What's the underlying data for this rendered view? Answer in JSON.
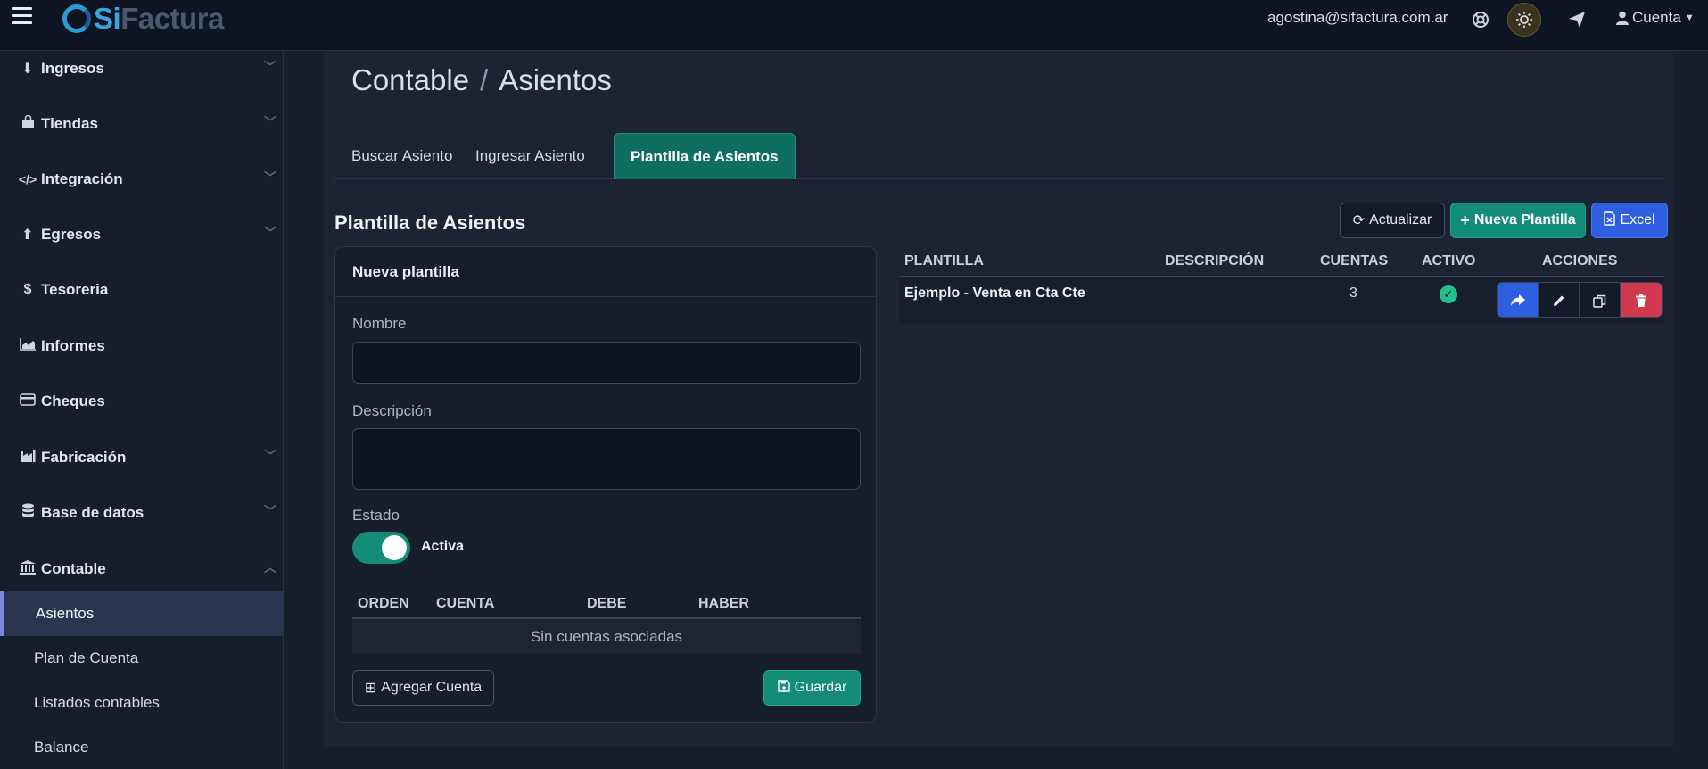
{
  "app": {
    "logo_prefix": "Si",
    "logo_suffix": "Factura"
  },
  "topbar": {
    "email": "agostina@sifactura.com.ar",
    "account_label": "Cuenta",
    "icons": [
      "menu-icon",
      "support-icon",
      "theme-toggle-icon",
      "send-icon",
      "user-icon",
      "caret-down-icon"
    ]
  },
  "sidebar": {
    "items": [
      {
        "label": "Ingresos",
        "icon": "download-icon",
        "has_submenu": true
      },
      {
        "label": "Tiendas",
        "icon": "bag-icon",
        "has_submenu": true
      },
      {
        "label": "Integración",
        "icon": "code-icon",
        "has_submenu": true
      },
      {
        "label": "Egresos",
        "icon": "upload-icon",
        "has_submenu": true
      },
      {
        "label": "Tesoreria",
        "icon": "dollar-icon",
        "has_submenu": false
      },
      {
        "label": "Informes",
        "icon": "area-chart-icon",
        "has_submenu": false
      },
      {
        "label": "Cheques",
        "icon": "card-icon",
        "has_submenu": false
      },
      {
        "label": "Fabricación",
        "icon": "factory-icon",
        "has_submenu": true
      },
      {
        "label": "Base de datos",
        "icon": "database-icon",
        "has_submenu": true
      },
      {
        "label": "Contable",
        "icon": "bank-icon",
        "has_submenu": true,
        "expanded": true
      }
    ],
    "subitems": [
      {
        "label": "Asientos",
        "active": true
      },
      {
        "label": "Plan de Cuenta",
        "active": false
      },
      {
        "label": "Listados contables",
        "active": false
      },
      {
        "label": "Balance",
        "active": false
      }
    ]
  },
  "breadcrumb": {
    "parent": "Contable",
    "separator": "/",
    "current": "Asientos"
  },
  "tabs": [
    {
      "label": "Buscar Asiento",
      "active": false
    },
    {
      "label": "Ingresar Asiento",
      "active": false
    },
    {
      "label": "Plantilla de Asientos",
      "active": true
    }
  ],
  "section": {
    "title": "Plantilla de Asientos",
    "buttons": {
      "refresh": "Actualizar",
      "new_template": "Nueva Plantilla",
      "excel": "Excel"
    }
  },
  "form": {
    "header": "Nueva plantilla",
    "name_label": "Nombre",
    "name_value": "",
    "description_label": "Descripción",
    "description_value": "",
    "state_label": "Estado",
    "state_value": "Activa",
    "state_on": true,
    "table_headers": [
      "ORDEN",
      "CUENTA",
      "DEBE",
      "HABER"
    ],
    "empty_text": "Sin cuentas asociadas",
    "add_account_label": "Agregar Cuenta",
    "save_label": "Guardar"
  },
  "templates_table": {
    "headers": [
      "PLANTILLA",
      "DESCRIPCIÓN",
      "CUENTAS",
      "ACTIVO",
      "ACCIONES"
    ],
    "rows": [
      {
        "name": "Ejemplo - Venta en Cta Cte",
        "description": "",
        "accounts": "3",
        "active": true
      }
    ],
    "action_icons": [
      "share-icon",
      "edit-icon",
      "copy-icon",
      "trash-icon"
    ]
  },
  "colors": {
    "accent_teal": "#138c79",
    "accent_blue": "#2f5fe0",
    "danger": "#d1394f",
    "background": "#161d2b"
  }
}
